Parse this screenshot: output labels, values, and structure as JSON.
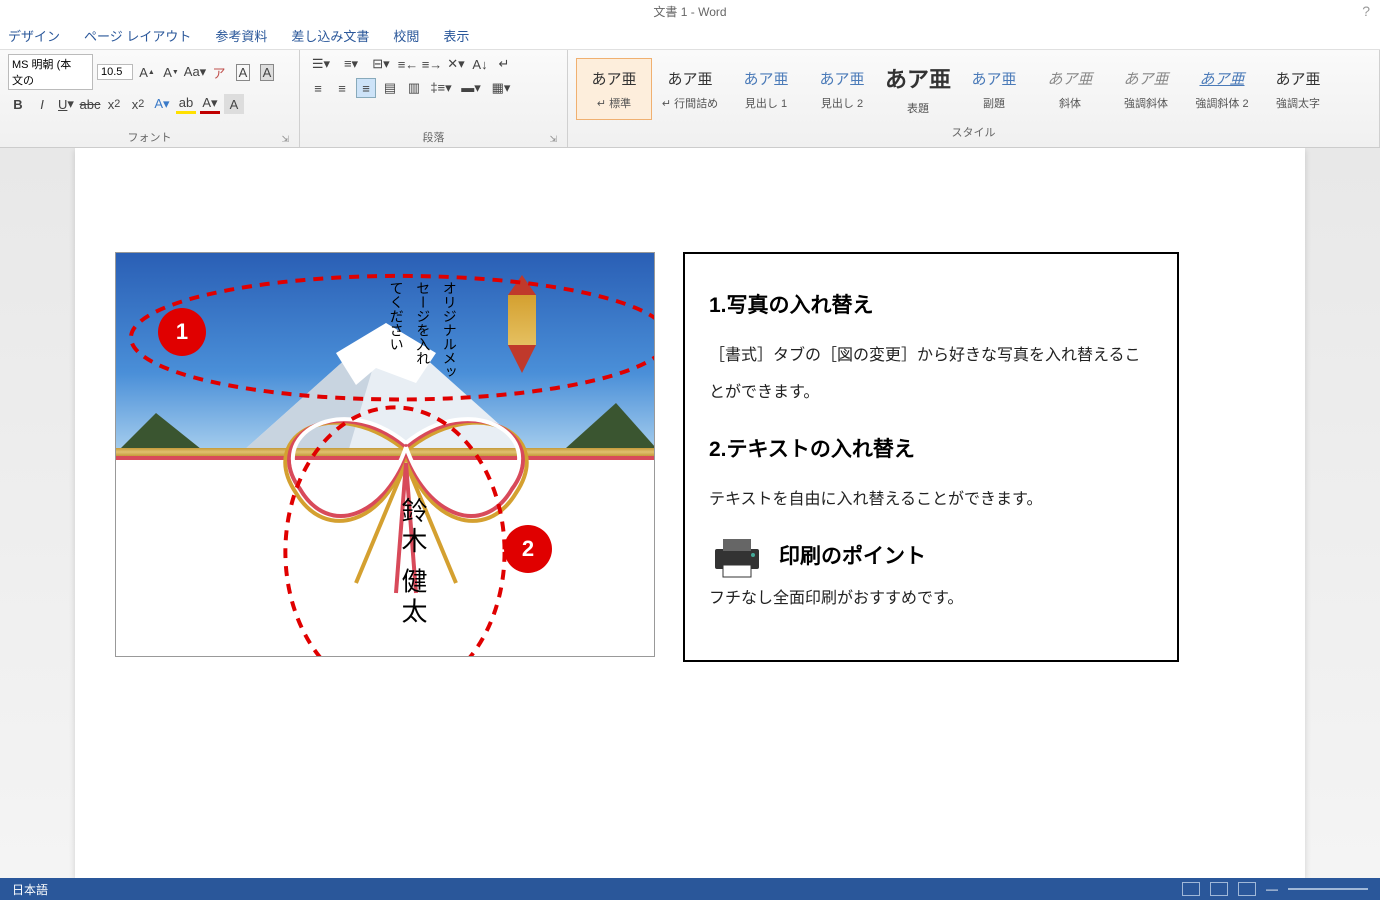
{
  "title": "文書 1 - Word",
  "menu": [
    "デザイン",
    "ページ レイアウト",
    "参考資料",
    "差し込み文書",
    "校閲",
    "表示"
  ],
  "ribbon": {
    "font_name": "MS 明朝 (本文の",
    "font_size": "10.5",
    "group_font": "フォント",
    "group_para": "段落",
    "group_styles": "スタイル"
  },
  "styles": [
    {
      "preview": "あア亜",
      "name": "↵ 標準",
      "cls": "selected"
    },
    {
      "preview": "あア亜",
      "name": "↵ 行間詰め",
      "cls": ""
    },
    {
      "preview": "あア亜",
      "name": "見出し 1",
      "cls": "accent"
    },
    {
      "preview": "あア亜",
      "name": "見出し 2",
      "cls": "accent"
    },
    {
      "preview": "あア亜",
      "name": "表題",
      "cls": "big"
    },
    {
      "preview": "あア亜",
      "name": "副題",
      "cls": "accent"
    },
    {
      "preview": "あア亜",
      "name": "斜体",
      "cls": "italic"
    },
    {
      "preview": "あア亜",
      "name": "強調斜体",
      "cls": "italic accent"
    },
    {
      "preview": "あア亜",
      "name": "強調斜体 2",
      "cls": "under"
    },
    {
      "preview": "あア亜",
      "name": "強調太字",
      "cls": ""
    }
  ],
  "card": {
    "message": "オリジナルメッ\nセージを入れ\nてください",
    "name": "鈴木 健太",
    "badge1": "1",
    "badge2": "2"
  },
  "instructions": {
    "h1": "1.写真の入れ替え",
    "p1": "［書式］タブの［図の変更］から好きな写真を入れ替えることができます。",
    "h2": "2.テキストの入れ替え",
    "p2": "テキストを自由に入れ替えることができます。",
    "h3": "印刷のポイント",
    "p3": "フチなし全面印刷がおすすめです。"
  },
  "status": {
    "lang": "日本語"
  }
}
